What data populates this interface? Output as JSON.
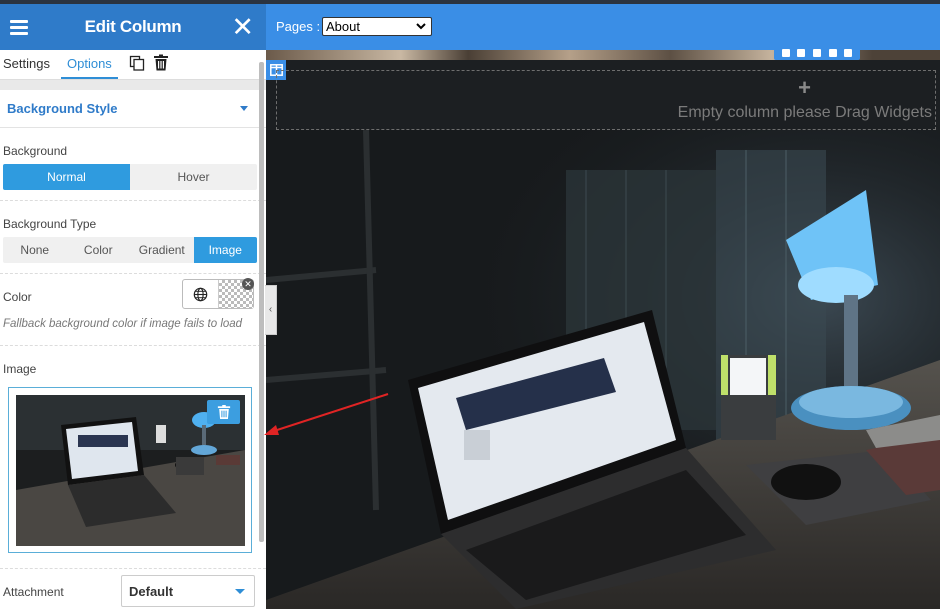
{
  "panel": {
    "title": "Edit Column",
    "tabs": {
      "settings": "Settings",
      "options": "Options"
    },
    "section_title": "Background Style",
    "background": {
      "label": "Background",
      "states": [
        "Normal",
        "Hover"
      ],
      "active_state": "Normal"
    },
    "background_type": {
      "label": "Background Type",
      "options": [
        "None",
        "Color",
        "Gradient",
        "Image"
      ],
      "active": "Image"
    },
    "color": {
      "label": "Color",
      "hint": "Fallback background color if image fails to load"
    },
    "image": {
      "label": "Image"
    },
    "attachment": {
      "label": "Attachment",
      "value": "Default"
    }
  },
  "canvas": {
    "pages_label": "Pages :",
    "pages_value": "About",
    "drop_zone_plus": "+",
    "drop_zone_message": "Empty column please Drag Widgets"
  },
  "icons": {
    "menu": "hamburger-icon",
    "close": "close-icon",
    "copy": "copy-icon",
    "delete": "trash-icon",
    "globe": "globe-icon",
    "collapse": "chevron-left-icon"
  },
  "colors": {
    "header": "#2f7bc9",
    "accent": "#2f9bdf",
    "pages_bar": "#3a8ee6",
    "arrow": "#e02424"
  }
}
